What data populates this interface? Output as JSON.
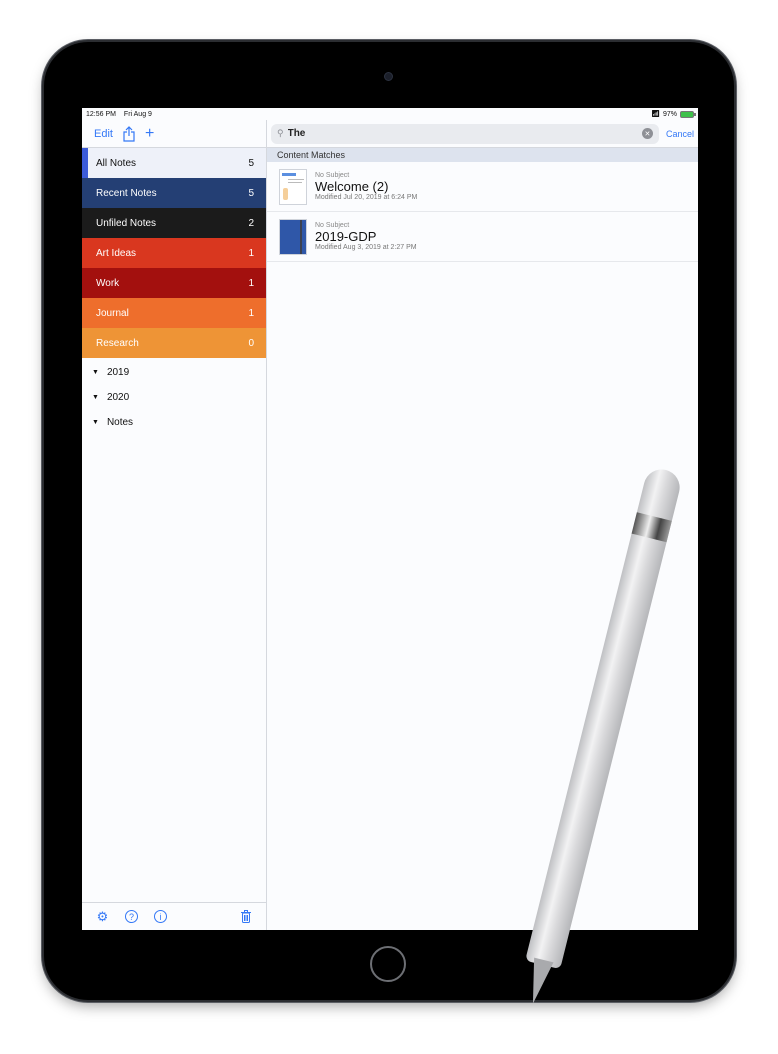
{
  "status_bar": {
    "time": "12:56 PM",
    "date": "Fri Aug 9",
    "battery": "97%",
    "wifi_icon": "wifi-icon",
    "battery_icon": "battery-charging-icon"
  },
  "sidebar": {
    "toolbar": {
      "edit_label": "Edit",
      "share_icon": "share-icon",
      "add_icon": "plus-icon"
    },
    "notebooks": [
      {
        "label": "All Notes",
        "count": "5",
        "color": "#eef1f9",
        "active": true
      },
      {
        "label": "Recent Notes",
        "count": "5",
        "color": "#243f74"
      },
      {
        "label": "Unfiled Notes",
        "count": "2",
        "color": "#1b1b1b"
      },
      {
        "label": "Art Ideas",
        "count": "1",
        "color": "#d9371f"
      },
      {
        "label": "Work",
        "count": "1",
        "color": "#a3100e"
      },
      {
        "label": "Journal",
        "count": "1",
        "color": "#ee6e2c"
      },
      {
        "label": "Research",
        "count": "0",
        "color": "#ee9436"
      }
    ],
    "folders": [
      {
        "label": "2019"
      },
      {
        "label": "2020"
      },
      {
        "label": "Notes"
      }
    ],
    "footer_icons": [
      "gear-icon",
      "help-icon",
      "info-icon",
      "trash-icon"
    ]
  },
  "search": {
    "value": "The",
    "cancel_label": "Cancel"
  },
  "results": {
    "section_title": "Content Matches",
    "notes": [
      {
        "subject": "No Subject",
        "title": "Welcome (2)",
        "modified": "Modified Jul 20, 2019 at 6:24 PM",
        "thumbnail": "welcome-page"
      },
      {
        "subject": "No Subject",
        "title": "2019-GDP",
        "modified": "Modified Aug 3, 2019 at 2:27 PM",
        "thumbnail": "blue-notebook-cover"
      }
    ]
  },
  "colors": {
    "accent": "#3478f6",
    "active_indicator": "#3b5bd9"
  }
}
